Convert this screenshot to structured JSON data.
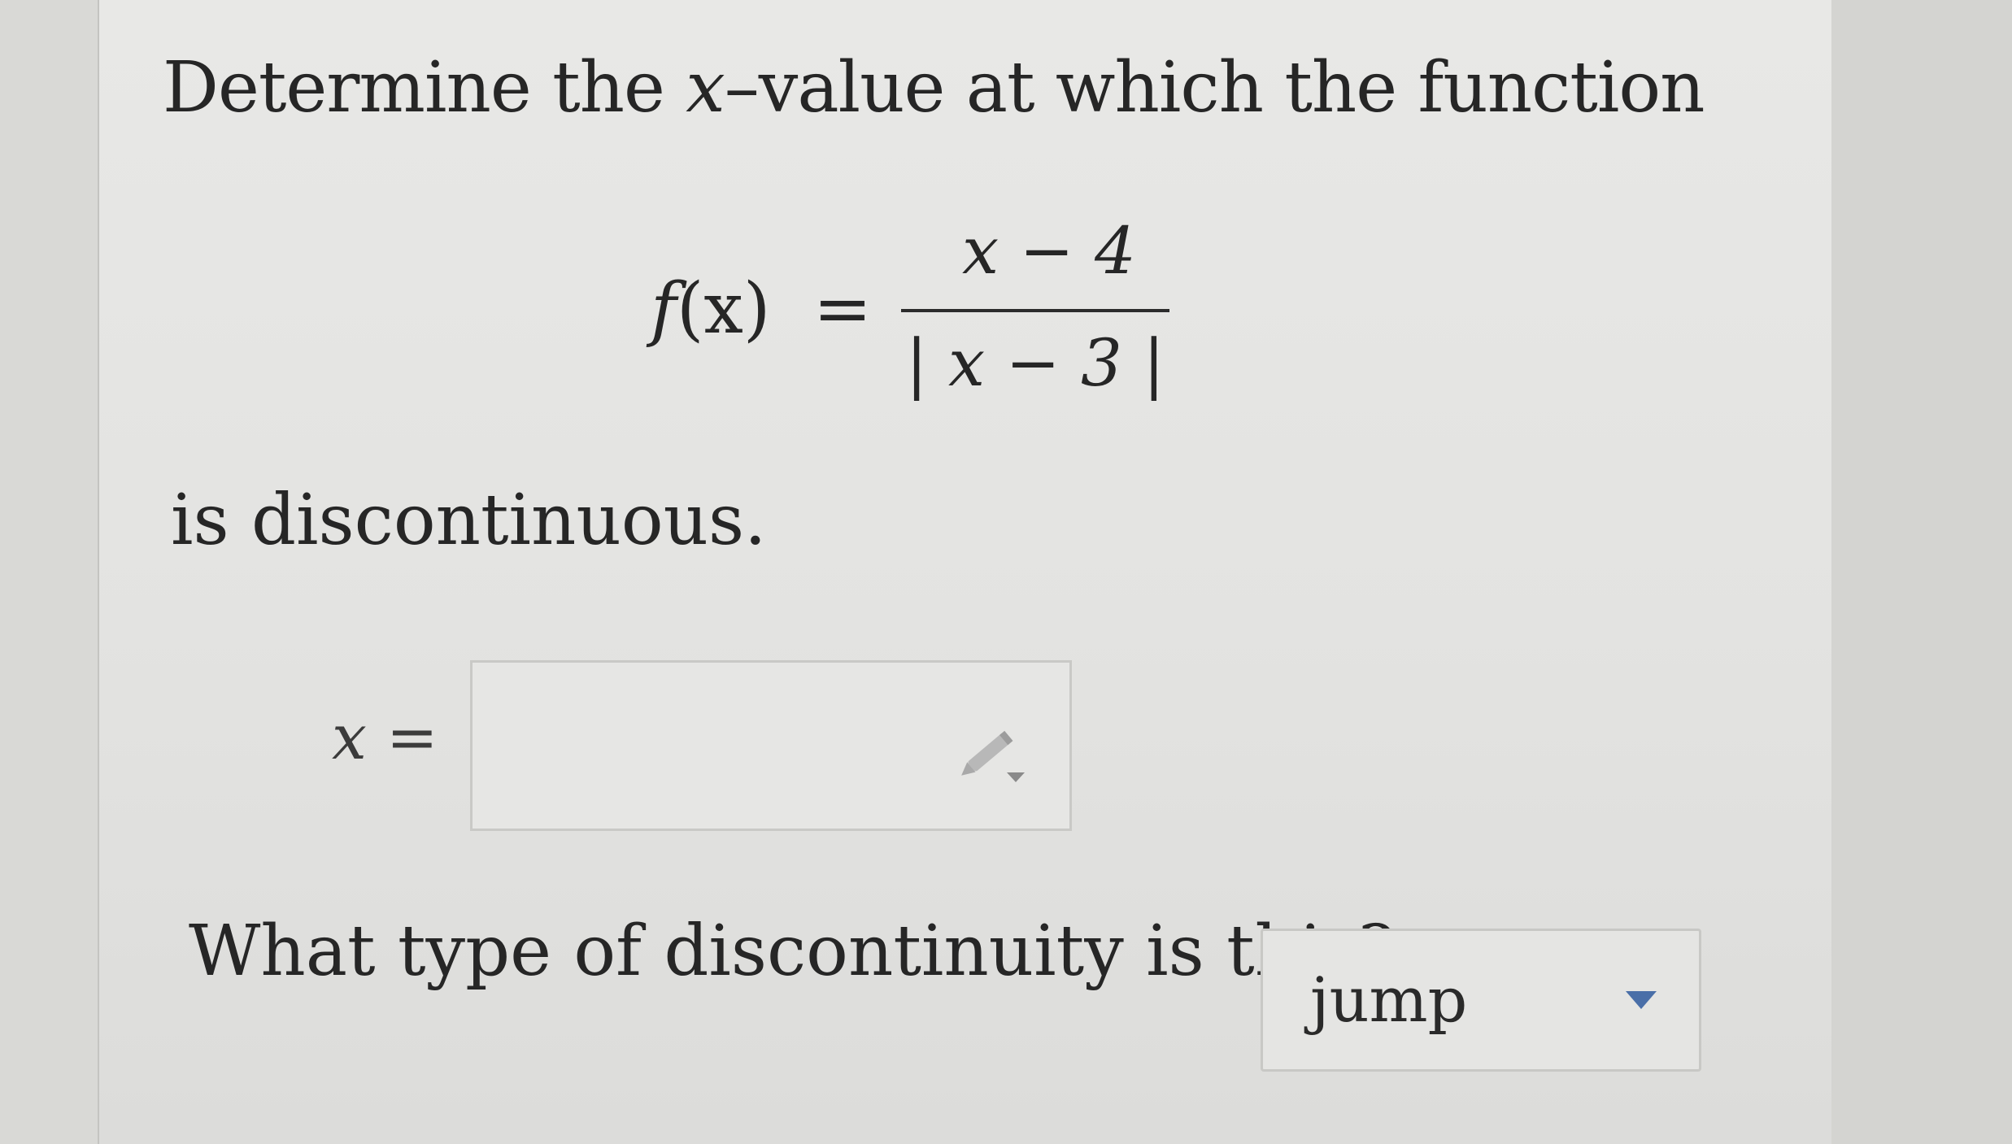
{
  "question": {
    "prompt_before": "Determine the ",
    "prompt_var": "x",
    "prompt_after": "–value at which the function",
    "function_name": "f",
    "function_arg": "(x)",
    "equals": "=",
    "numerator": "x − 4",
    "denominator": "| x − 3 |",
    "after_text": "is discontinuous."
  },
  "answer": {
    "label": "x =",
    "value": "",
    "editor_icon": "pencil-icon"
  },
  "type_question": {
    "text": "What type of discontinuity is this?",
    "selected": "jump",
    "caret_icon": "chevron-down-icon",
    "caret_color": "#4a6fa8"
  }
}
